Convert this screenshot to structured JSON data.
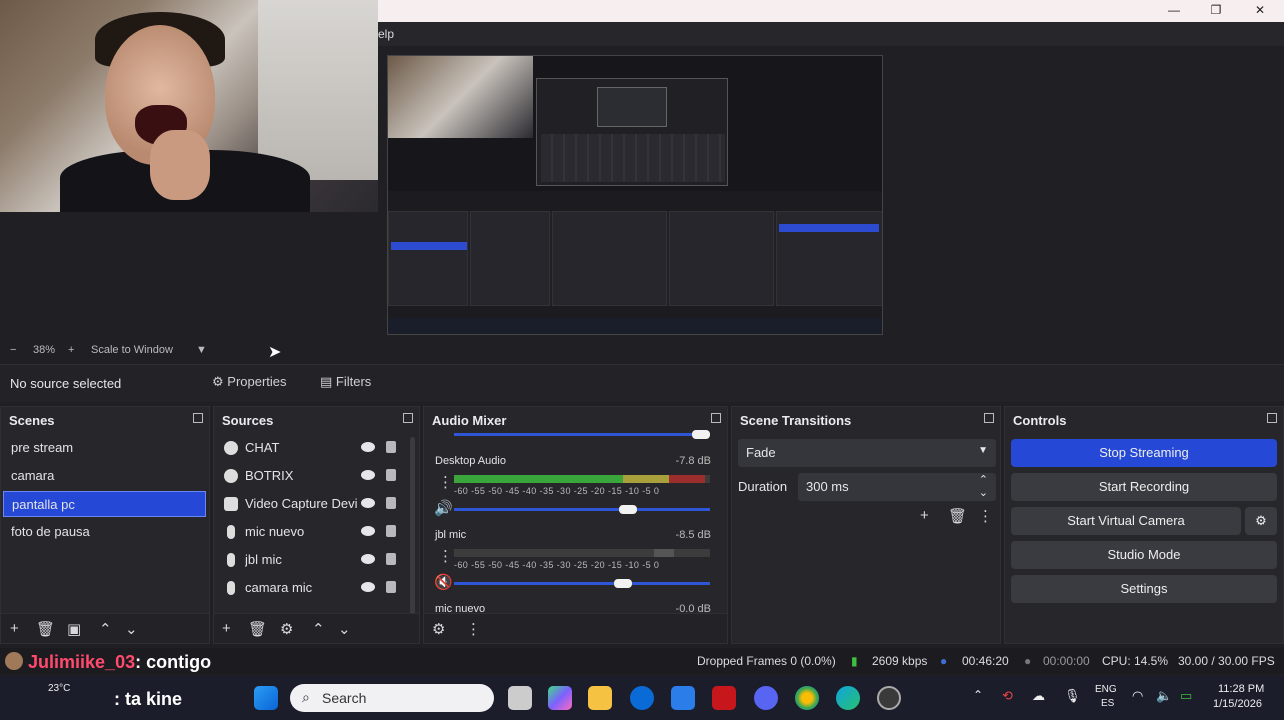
{
  "window": {
    "menu_fragment": "elp",
    "minimize": "—",
    "maximize": "❐",
    "close": "✕"
  },
  "preview": {
    "zoom_minus": "−",
    "zoom_level": "38%",
    "zoom_plus": "+",
    "scale_mode": "Scale to Window"
  },
  "source_bar": {
    "status": "No source selected",
    "properties_label": "Properties",
    "filters_label": "Filters"
  },
  "scenes": {
    "title": "Scenes",
    "items": [
      "pre stream",
      "camara",
      "pantalla pc",
      "foto de pausa"
    ],
    "selected": "pantalla pc"
  },
  "sources": {
    "title": "Sources",
    "items": [
      "CHAT",
      "BOTRIX",
      "Video Capture Devi",
      "mic nuevo",
      "jbl mic",
      "camara mic"
    ]
  },
  "audio_mixer": {
    "title": "Audio Mixer",
    "channels": [
      {
        "name": "Desktop Audio",
        "db": "-7.8 dB",
        "level": 0.98,
        "volume": 0.68
      },
      {
        "name": "jbl mic",
        "db": "-8.5 dB",
        "level": 0.0,
        "volume": 0.66
      },
      {
        "name": "mic nuevo",
        "db": "-0.0 dB"
      }
    ],
    "scale_text": "-60 -55 -50 -45 -40 -35 -30 -25 -20 -15 -10 -5 0"
  },
  "scene_transitions": {
    "title": "Scene Transitions",
    "transition": "Fade",
    "duration_label": "Duration",
    "duration_value": "300 ms"
  },
  "controls": {
    "title": "Controls",
    "stop_streaming": "Stop Streaming",
    "start_recording": "Start Recording",
    "start_virtual_camera": "Start Virtual Camera",
    "studio_mode": "Studio Mode",
    "settings": "Settings"
  },
  "status": {
    "dropped_frames": "Dropped Frames 0 (0.0%)",
    "bitrate": "2609 kbps",
    "stream_time": "00:46:20",
    "record_time": "00:00:00",
    "cpu": "CPU: 14.5%",
    "fps": "30.00 / 30.00 FPS"
  },
  "chat": {
    "user": "Julimiike_03",
    "message": ": contigo"
  },
  "chat2": {
    "message": ": ta kine"
  },
  "taskbar": {
    "weather": "23°C",
    "search_placeholder": "Search",
    "lang_top": "ENG",
    "lang_bottom": "ES",
    "time": "11:28 PM",
    "date": "1/15/2026"
  },
  "colors": {
    "accent": "#2549d6",
    "meter_green": "#3aa53a",
    "meter_yellow": "#a8a13b",
    "meter_red": "#9c2d2d"
  }
}
